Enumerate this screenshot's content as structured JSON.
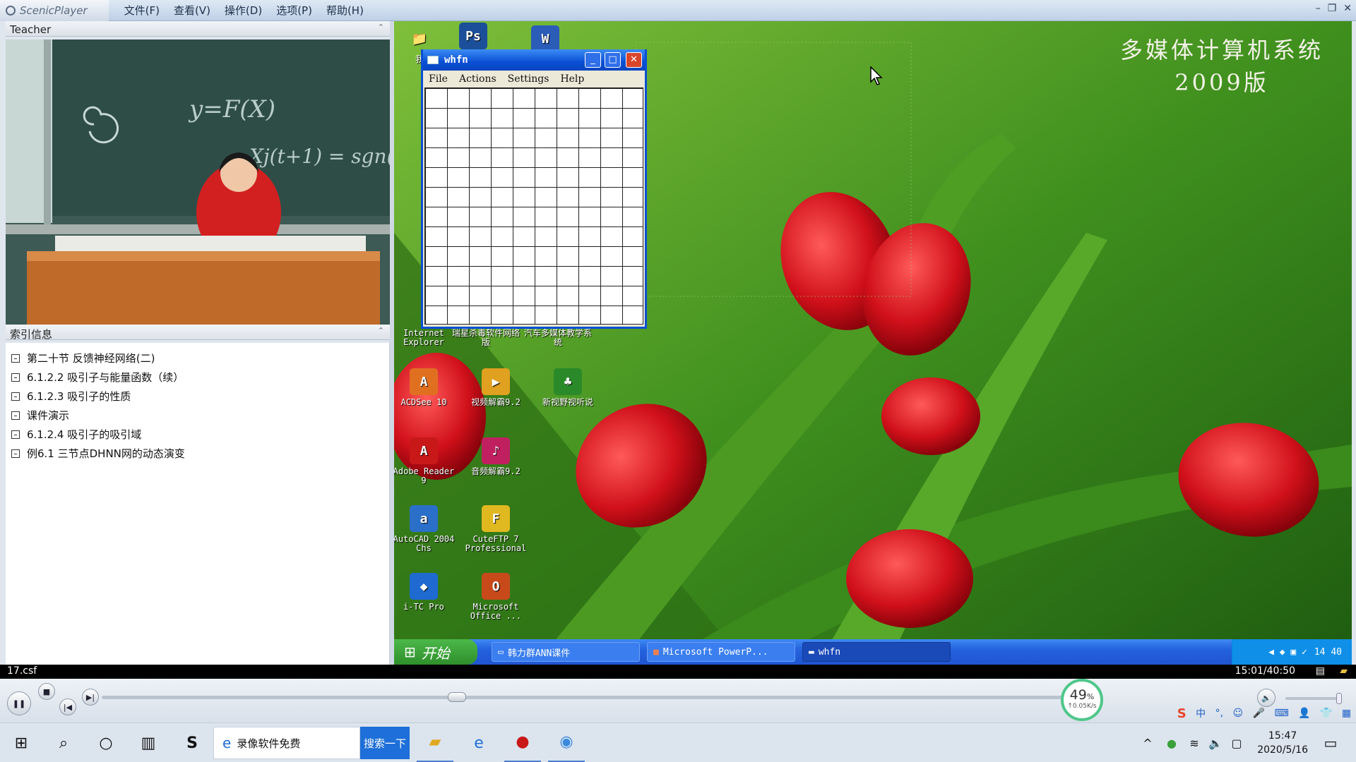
{
  "app": {
    "name": "ScenicPlayer",
    "menu": [
      "文件(F)",
      "查看(V)",
      "操作(D)",
      "选项(P)",
      "帮助(H)"
    ]
  },
  "video_panel": {
    "title": "Teacher",
    "board_text_1": "y=F(X)",
    "board_text_2": "Xj(t+1) = sgn(..."
  },
  "toc": {
    "title": "索引信息",
    "items": [
      "第二十节 反馈神经网络(二)",
      "6.1.2.2 吸引子与能量函数（续）",
      "6.1.2.3 吸引子的性质",
      "课件演示",
      "6.1.2.4 吸引子的吸引域",
      "例6.1 三节点DHNN网的动态演变"
    ]
  },
  "desktop": {
    "overlay_line1": "多媒体计算机系统",
    "overlay_line2": "2009版",
    "icons": [
      {
        "label": "我的",
        "short": "我",
        "glyph": "📁",
        "color": "#e8b030"
      },
      {
        "label": "Ps",
        "short": "Ps",
        "glyph": "Ps",
        "color": "#1b4f9a"
      },
      {
        "label": "W",
        "short": "W",
        "glyph": "W",
        "color": "#2b5cb8"
      },
      {
        "label": "Internet Explorer",
        "glyph": "e",
        "color": "#2a7fe0"
      },
      {
        "label": "瑞星杀毒软件网络版",
        "glyph": "R",
        "color": "#1a66c4"
      },
      {
        "label": "汽车多媒体教学系统",
        "glyph": "C",
        "color": "#3a8a3a"
      },
      {
        "label": "ACDSee 10",
        "glyph": "A",
        "color": "#e07020"
      },
      {
        "label": "视频解霸9.2",
        "glyph": "▶",
        "color": "#e0a020"
      },
      {
        "label": "新视野视听说",
        "glyph": "♣",
        "color": "#2a8a2a"
      },
      {
        "label": "Adobe Reader 9",
        "glyph": "A",
        "color": "#c81818"
      },
      {
        "label": "音频解霸9.2",
        "glyph": "♪",
        "color": "#c02060"
      },
      {
        "label": "AutoCAD 2004 Chs",
        "glyph": "a",
        "color": "#2a6fc8"
      },
      {
        "label": "CuteFTP 7 Professional",
        "glyph": "F",
        "color": "#e0b820"
      },
      {
        "label": "i-TC Pro",
        "glyph": "◆",
        "color": "#1e6ad0"
      },
      {
        "label": "Microsoft Office ...",
        "glyph": "O",
        "color": "#c84a1a"
      }
    ],
    "whfn": {
      "title": "whfn",
      "menu": [
        "File",
        "Actions",
        "Settings",
        "Help"
      ]
    },
    "taskbar": {
      "start": "开始",
      "tasks": [
        "韩力群ANN课件",
        "Microsoft PowerP...",
        "whfn"
      ],
      "clock": "14 40"
    }
  },
  "status": {
    "filename": "17.csf",
    "time": "15:01/40:50"
  },
  "player": {
    "progress": 0.37,
    "net_percent": "49",
    "net_unit": "%",
    "net_rate": "↑0.05K/s"
  },
  "ime": [
    "S",
    "中",
    "°,",
    "☺",
    "🎤",
    "⌨",
    "👤",
    "👕",
    "▦"
  ],
  "windows_taskbar": {
    "search_text": "录像软件免费",
    "search_button": "搜索一下",
    "time": "15:47",
    "date": "2020/5/16"
  }
}
